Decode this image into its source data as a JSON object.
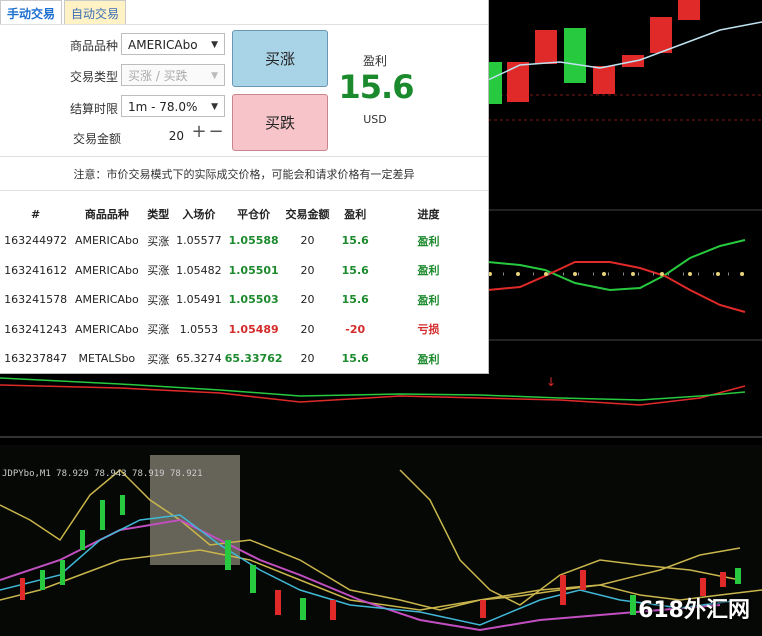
{
  "tabs": [
    "手动交易",
    "自动交易"
  ],
  "form": {
    "product_label": "商品品种",
    "product_value": "AMERICAbo",
    "type_label": "交易类型",
    "type_value": "买涨 / 买跌",
    "expiry_label": "结算时限",
    "expiry_value": "1m - 78.0%",
    "amount_label": "交易金额",
    "amount_value": "20",
    "plus": "+",
    "minus": "−"
  },
  "buttons": {
    "buy_up": "买涨",
    "buy_down": "买跌"
  },
  "profit": {
    "label": "盈利",
    "value": "15.6",
    "unit": "USD"
  },
  "notice": "注意：市价交易模式下的实际成交价格，可能会和请求价格有一定差异",
  "table": {
    "headers": [
      "#",
      "商品品种",
      "类型",
      "入场价",
      "平仓价",
      "交易金额",
      "盈利",
      "进度"
    ],
    "rows": [
      [
        "163244972",
        "AMERICAbo",
        "买涨",
        "1.05577",
        "1.05588",
        "20",
        "15.6",
        "盈利"
      ],
      [
        "163241612",
        "AMERICAbo",
        "买涨",
        "1.05482",
        "1.05501",
        "20",
        "15.6",
        "盈利"
      ],
      [
        "163241578",
        "AMERICAbo",
        "买涨",
        "1.05491",
        "1.05503",
        "20",
        "15.6",
        "盈利"
      ],
      [
        "163241243",
        "AMERICAbo",
        "买涨",
        "1.0553",
        "1.05489",
        "20",
        "-20",
        "亏损"
      ],
      [
        "163237847",
        "METALSbo",
        "买涨",
        "65.3274",
        "65.33762",
        "20",
        "15.6",
        "盈利"
      ]
    ]
  },
  "chart_header": "JDPYbo,M1  78.929 78.943 78.919 78.921",
  "watermark": "618外汇网",
  "colors": {
    "up": "#1d8a2e",
    "down": "#d42b2b",
    "btn_up": "#a9d3e7",
    "btn_down": "#f6c4c9"
  }
}
